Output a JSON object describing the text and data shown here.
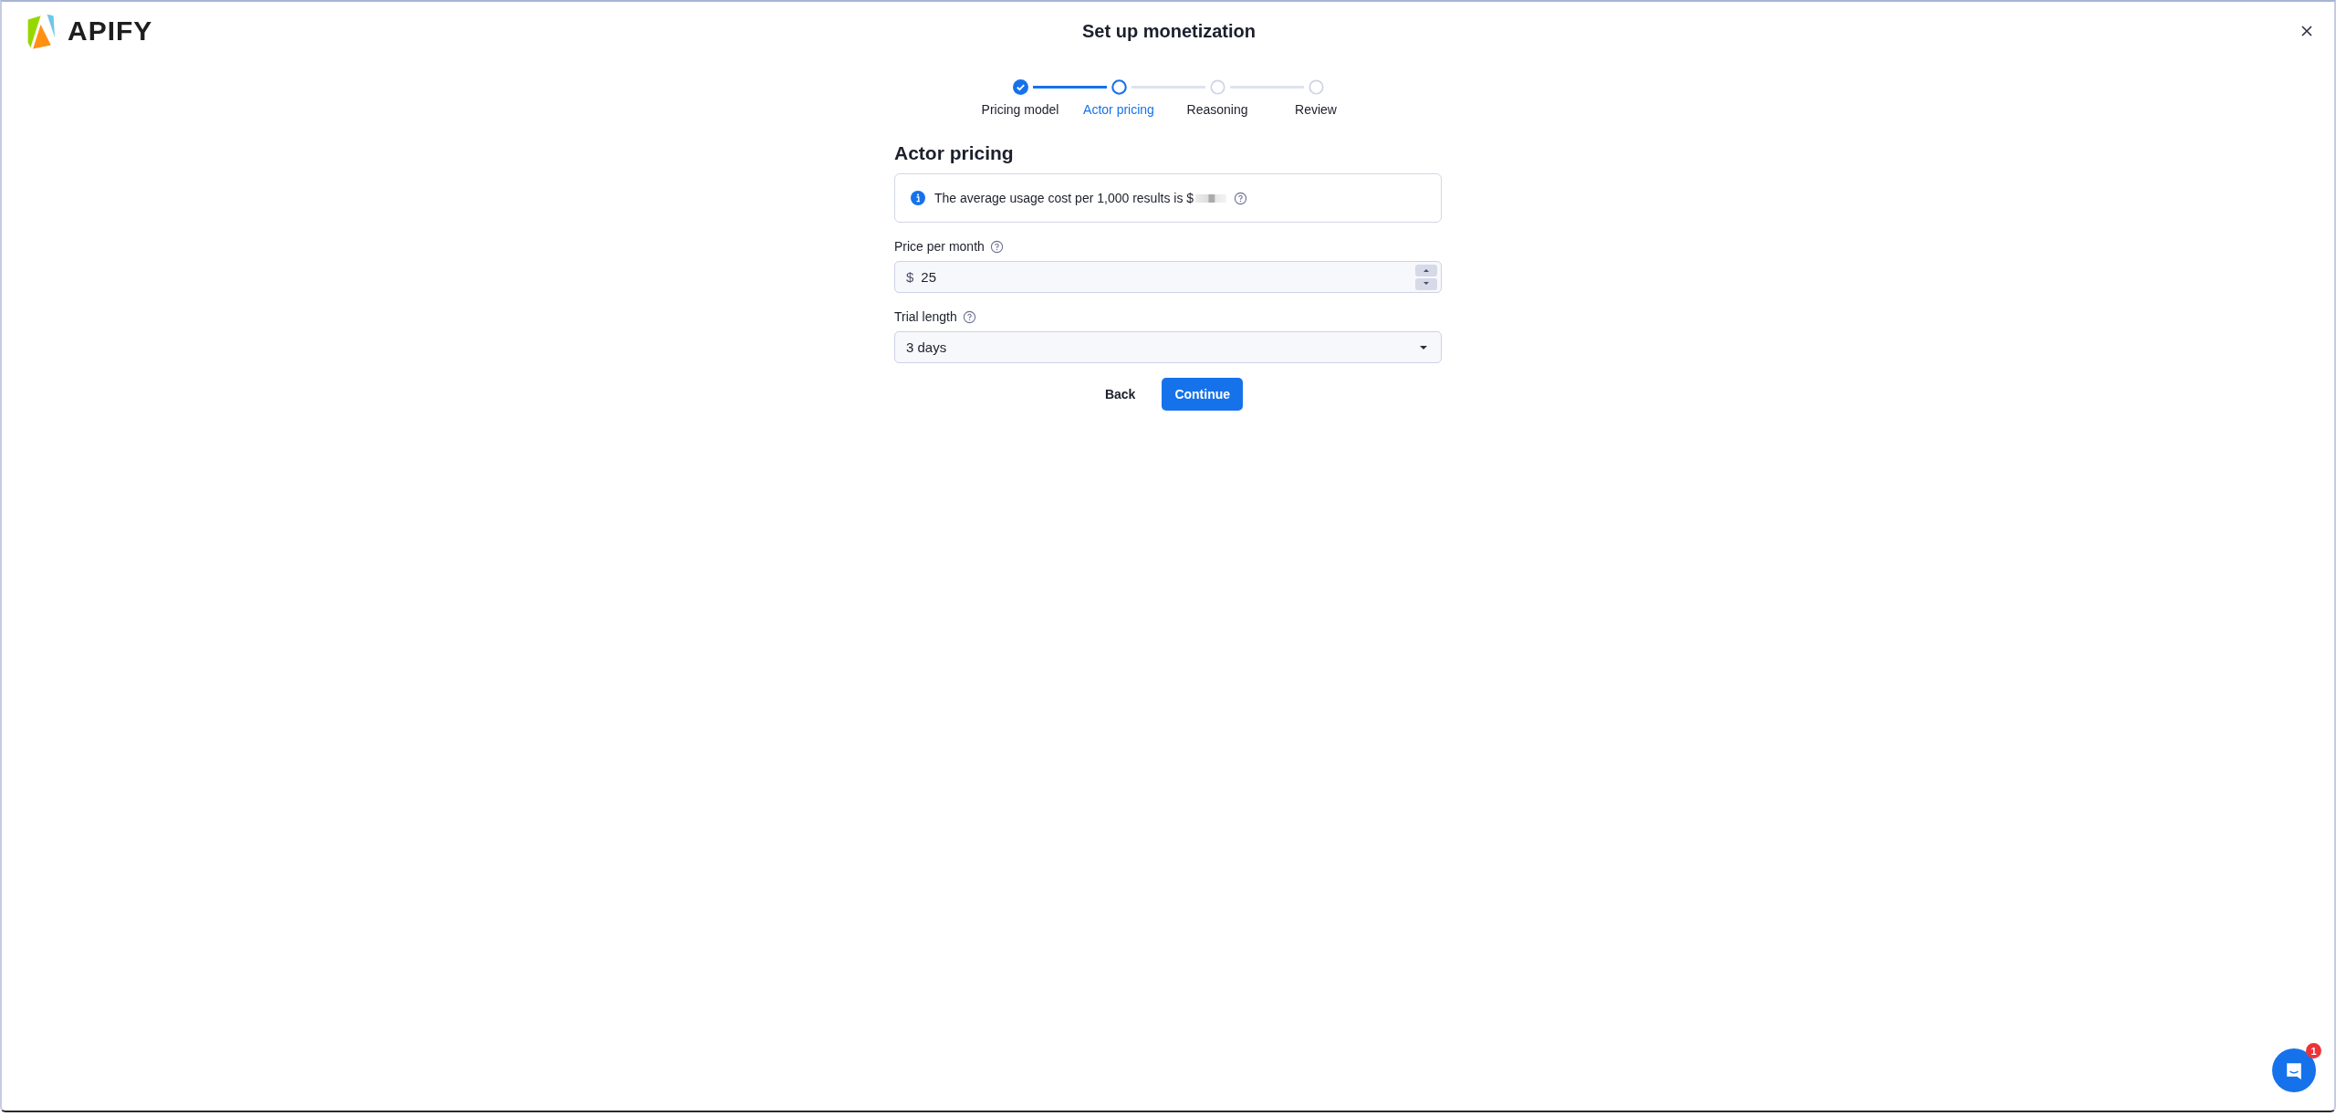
{
  "header": {
    "logo_text": "APIFY",
    "title": "Set up monetization"
  },
  "steps": [
    {
      "label": "Pricing model",
      "completed": true,
      "selected": false
    },
    {
      "label": "Actor pricing",
      "completed": false,
      "selected": true
    },
    {
      "label": "Reasoning",
      "completed": false,
      "selected": false
    },
    {
      "label": "Review",
      "completed": false,
      "selected": false
    }
  ],
  "section": {
    "heading": "Actor pricing",
    "info": "The average usage cost per 1,000 results is $"
  },
  "fields": [
    {
      "kind": "number",
      "label": "Price per month",
      "prefix": "$",
      "value": "25"
    },
    {
      "kind": "select",
      "label": "Trial length",
      "value": "3 days"
    }
  ],
  "buttons": [
    {
      "label": "Back",
      "kind": "text"
    },
    {
      "label": "Continue",
      "kind": "primary"
    }
  ],
  "chat": {
    "badge": "1"
  }
}
